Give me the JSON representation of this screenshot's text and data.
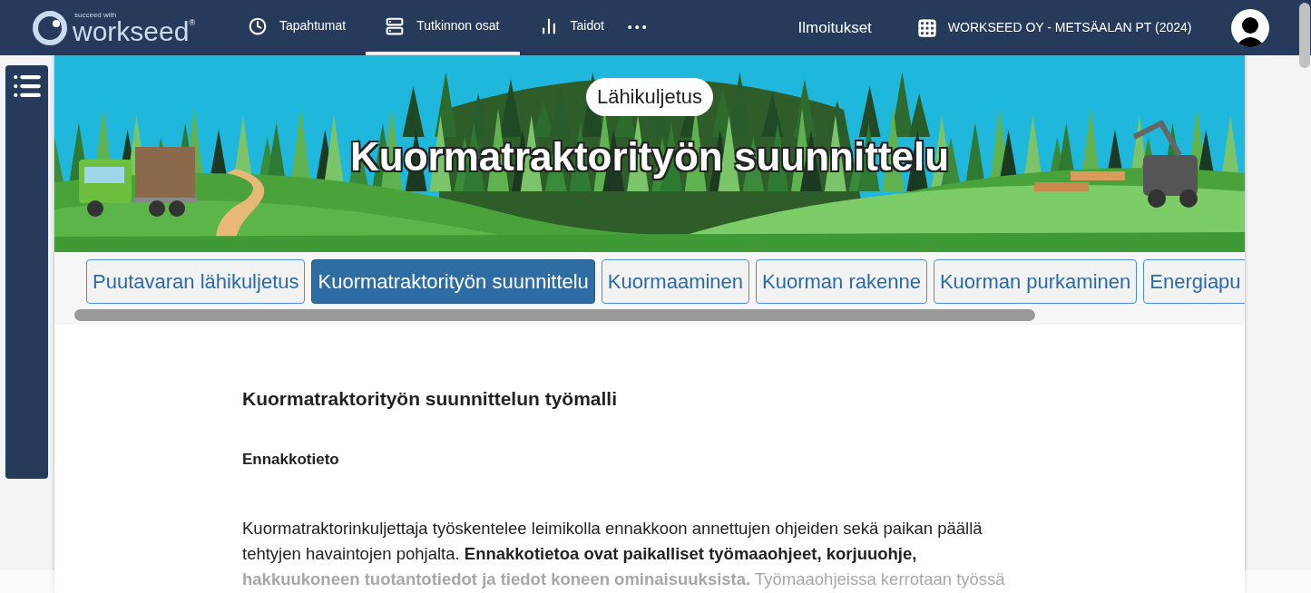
{
  "header": {
    "logo": {
      "tagline": "succeed with",
      "name": "workseed",
      "mark": "®"
    },
    "nav": [
      {
        "label": "Tapahtumat",
        "kind": "clock",
        "selected": false
      },
      {
        "label": "Tutkinnon osat",
        "kind": "stack",
        "selected": true
      },
      {
        "label": "Taidot",
        "kind": "bars",
        "selected": false
      }
    ],
    "more": "•••",
    "notifications": "Ilmoitukset",
    "organization": "WORKSEED OY - METSÄALAN PT (2024)"
  },
  "banner": {
    "badge": "Lähikuljetus",
    "title": "Kuormatraktorityön suunnittelu"
  },
  "tabs": [
    {
      "label": "Puutavaran lähikuljetus",
      "selected": false
    },
    {
      "label": "Kuormatraktorityön suunnittelu",
      "selected": true
    },
    {
      "label": "Kuormaaminen",
      "selected": false
    },
    {
      "label": "Kuorman rakenne",
      "selected": false
    },
    {
      "label": "Kuorman purkaminen",
      "selected": false
    },
    {
      "label": "Energiapu",
      "selected": false
    }
  ],
  "article": {
    "heading": "Kuormatraktorityön suunnittelun työmalli",
    "subheading": "Ennakkotieto",
    "paragraph": "Kuormatraktorinkuljettaja työskentelee leimikolla ennakkoon annettujen ohjeiden sekä paikan päällä tehtyjen havaintojen pohjalta. **Ennakkotietoa ovat paikalliset työmaaohjeet, korjuuohje, hakkuukoneen tuotantotiedot ja tiedot koneen ominaisuuksista.** Työmaaohjeissa kerrotaan työssä"
  }
}
